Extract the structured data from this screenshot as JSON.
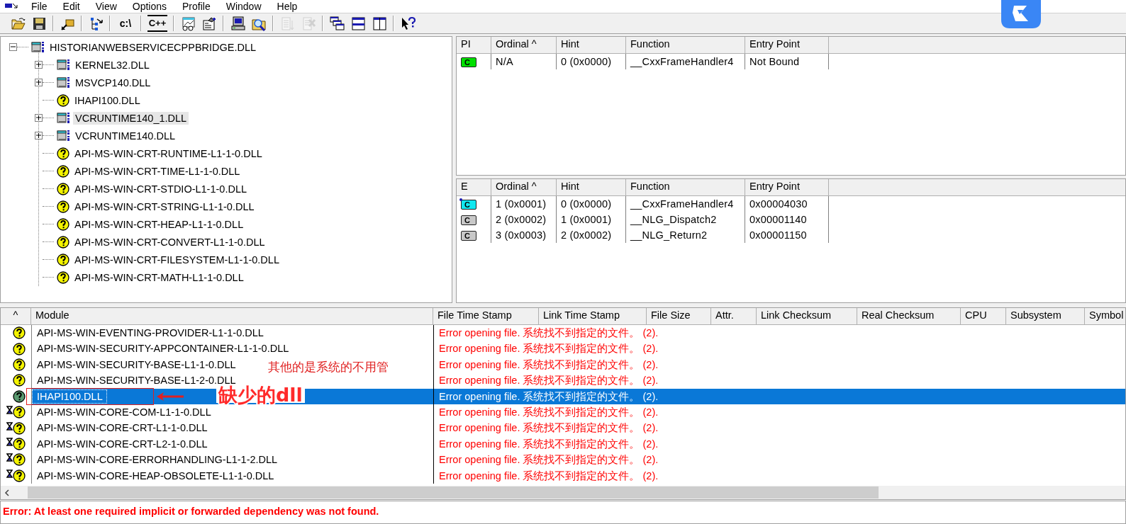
{
  "menu": [
    {
      "label": "File"
    },
    {
      "label": "Edit"
    },
    {
      "label": "View"
    },
    {
      "label": "Options"
    },
    {
      "label": "Profile"
    },
    {
      "label": "Window"
    },
    {
      "label": "Help"
    }
  ],
  "toolbar": {
    "groups": [
      [
        {
          "kind": "open",
          "disabled": false
        },
        {
          "kind": "save",
          "disabled": false
        }
      ],
      [
        {
          "kind": "attach",
          "disabled": false
        }
      ],
      [
        {
          "kind": "tree",
          "disabled": false
        }
      ],
      [
        {
          "kind": "text",
          "label": "c:\\",
          "disabled": false
        }
      ],
      [
        {
          "kind": "text",
          "label": "C++",
          "disabled": false
        }
      ],
      [
        {
          "kind": "chart",
          "disabled": false
        },
        {
          "kind": "properties",
          "disabled": false
        }
      ],
      [
        {
          "kind": "computer",
          "disabled": false
        },
        {
          "kind": "search",
          "disabled": false
        }
      ],
      [
        {
          "kind": "list",
          "disabled": true
        },
        {
          "kind": "xlist",
          "disabled": true
        }
      ],
      [
        {
          "kind": "cascade",
          "disabled": false
        },
        {
          "kind": "tile_h",
          "disabled": false
        },
        {
          "kind": "tile_v",
          "disabled": false
        }
      ],
      [
        {
          "kind": "help",
          "disabled": false
        }
      ]
    ]
  },
  "tree": {
    "label": "HISTORIANWEBSERVICECPPBRIDGE.DLL",
    "kind": "module64",
    "expandable": true,
    "expanded": true,
    "selected": false,
    "children": [
      {
        "label": "KERNEL32.DLL",
        "kind": "module64",
        "expandable": true,
        "selected": false
      },
      {
        "label": "MSVCP140.DLL",
        "kind": "module64",
        "expandable": true,
        "selected": false
      },
      {
        "label": "IHAPI100.DLL",
        "kind": "missing",
        "expandable": false,
        "selected": false
      },
      {
        "label": "VCRUNTIME140_1.DLL",
        "kind": "module64",
        "expandable": true,
        "selected": true
      },
      {
        "label": "VCRUNTIME140.DLL",
        "kind": "module64",
        "expandable": true,
        "selected": false
      },
      {
        "label": "API-MS-WIN-CRT-RUNTIME-L1-1-0.DLL",
        "kind": "missing",
        "expandable": false,
        "selected": false
      },
      {
        "label": "API-MS-WIN-CRT-TIME-L1-1-0.DLL",
        "kind": "missing",
        "expandable": false,
        "selected": false
      },
      {
        "label": "API-MS-WIN-CRT-STDIO-L1-1-0.DLL",
        "kind": "missing",
        "expandable": false,
        "selected": false
      },
      {
        "label": "API-MS-WIN-CRT-STRING-L1-1-0.DLL",
        "kind": "missing",
        "expandable": false,
        "selected": false
      },
      {
        "label": "API-MS-WIN-CRT-HEAP-L1-1-0.DLL",
        "kind": "missing",
        "expandable": false,
        "selected": false
      },
      {
        "label": "API-MS-WIN-CRT-CONVERT-L1-1-0.DLL",
        "kind": "missing",
        "expandable": false,
        "selected": false
      },
      {
        "label": "API-MS-WIN-CRT-FILESYSTEM-L1-1-0.DLL",
        "kind": "missing",
        "expandable": false,
        "selected": false
      },
      {
        "label": "API-MS-WIN-CRT-MATH-L1-1-0.DLL",
        "kind": "missing",
        "expandable": false,
        "selected": false
      }
    ]
  },
  "parent_imports": {
    "columns": [
      "PI",
      "Ordinal ^",
      "Hint",
      "Function",
      "Entry Point"
    ],
    "rows": [
      {
        "kind": "bound_import",
        "badge": "C",
        "ordinal": "N/A",
        "hint": "0 (0x0000)",
        "function": "__CxxFrameHandler4",
        "entry_point": "Not Bound"
      }
    ]
  },
  "exports": {
    "columns": [
      "E",
      "Ordinal ^",
      "Hint",
      "Function",
      "Entry Point"
    ],
    "rows": [
      {
        "kind": "called_export",
        "badge": "C",
        "ordinal": "1 (0x0001)",
        "hint": "0 (0x0000)",
        "function": "__CxxFrameHandler4",
        "entry_point": "0x00004030"
      },
      {
        "kind": "export",
        "badge": "C",
        "ordinal": "2 (0x0002)",
        "hint": "1 (0x0001)",
        "function": "__NLG_Dispatch2",
        "entry_point": "0x00001140"
      },
      {
        "kind": "export",
        "badge": "C",
        "ordinal": "3 (0x0003)",
        "hint": "2 (0x0002)",
        "function": "__NLG_Return2",
        "entry_point": "0x00001150"
      }
    ]
  },
  "modules": {
    "columns": [
      "^",
      "Module",
      "File Time Stamp",
      "Link Time Stamp",
      "File Size",
      "Attr.",
      "Link Checksum",
      "Real Checksum",
      "CPU",
      "Subsystem",
      "Symbol"
    ],
    "rows": [
      {
        "kind": "missing",
        "selected": false,
        "module": "API-MS-WIN-EVENTING-PROVIDER-L1-1-0.DLL",
        "file_time_stamp": "Error opening file. 系统找不到指定的文件。 (2)."
      },
      {
        "kind": "missing",
        "selected": false,
        "module": "API-MS-WIN-SECURITY-APPCONTAINER-L1-1-0.DLL",
        "file_time_stamp": "Error opening file. 系统找不到指定的文件。 (2)."
      },
      {
        "kind": "missing",
        "selected": false,
        "module": "API-MS-WIN-SECURITY-BASE-L1-1-0.DLL",
        "file_time_stamp": "Error opening file. 系统找不到指定的文件。 (2)."
      },
      {
        "kind": "missing",
        "selected": false,
        "module": "API-MS-WIN-SECURITY-BASE-L1-2-0.DLL",
        "file_time_stamp": "Error opening file. 系统找不到指定的文件。 (2)."
      },
      {
        "kind": "missing",
        "selected": true,
        "module": "IHAPI100.DLL",
        "file_time_stamp": "Error opening file. 系统找不到指定的文件。 (2)."
      },
      {
        "kind": "missing_delay",
        "selected": false,
        "module": "API-MS-WIN-CORE-COM-L1-1-0.DLL",
        "file_time_stamp": "Error opening file. 系统找不到指定的文件。 (2)."
      },
      {
        "kind": "missing_delay",
        "selected": false,
        "module": "API-MS-WIN-CORE-CRT-L1-1-0.DLL",
        "file_time_stamp": "Error opening file. 系统找不到指定的文件。 (2)."
      },
      {
        "kind": "missing_delay",
        "selected": false,
        "module": "API-MS-WIN-CORE-CRT-L2-1-0.DLL",
        "file_time_stamp": "Error opening file. 系统找不到指定的文件。 (2)."
      },
      {
        "kind": "missing_delay",
        "selected": false,
        "module": "API-MS-WIN-CORE-ERRORHANDLING-L1-1-2.DLL",
        "file_time_stamp": "Error opening file. 系统找不到指定的文件。 (2)."
      },
      {
        "kind": "missing_delay",
        "selected": false,
        "module": "API-MS-WIN-CORE-HEAP-OBSOLETE-L1-1-0.DLL",
        "file_time_stamp": "Error opening file. 系统找不到指定的文件。 (2)."
      }
    ],
    "annotations": [
      {
        "kind": "note",
        "text": "其他的是系统的不用管"
      },
      {
        "kind": "callout",
        "text": "缺少的dll"
      }
    ]
  },
  "log": [
    {
      "kind": "error",
      "text": "Error: At least one required implicit or forwarded dependency was not found."
    }
  ]
}
